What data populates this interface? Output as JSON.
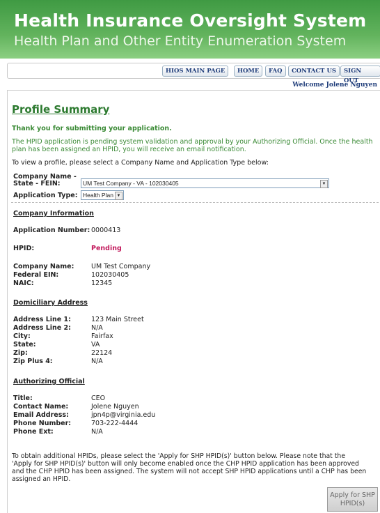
{
  "header": {
    "title": "Health Insurance Oversight System",
    "subtitle": "Health Plan and Other Entity Enumeration System"
  },
  "nav": {
    "items": [
      "HIOS MAIN PAGE",
      "HOME",
      "FAQ",
      "CONTACT US",
      "SIGN OUT"
    ]
  },
  "welcome": "Welcome Jolene Nguyen",
  "page": {
    "title": "Profile Summary",
    "thank_you": "Thank you for submitting your application.",
    "notice_line1": "The HPID application is pending system validation and approval by your Authorizing Official. Once the health",
    "notice_line2": "plan has been assigned an HPID, you will receive an email notification.",
    "select_prompt": "To view a profile, please select a Company Name and Application Type below:"
  },
  "filters": {
    "company_label_line1": "Company Name -",
    "company_label_line2": "State - FEIN:",
    "company_value": "UM Test Company - VA - 102030405",
    "apptype_label": "Application Type:",
    "apptype_value": "Health Plan"
  },
  "company_info": {
    "heading": "Company Information",
    "app_number_label": "Application Number:",
    "app_number": "0000413",
    "hpid_label": "HPID:",
    "hpid": "Pending",
    "company_name_label": "Company Name:",
    "company_name": "UM Test Company",
    "fein_label": "Federal EIN:",
    "fein": "102030405",
    "naic_label": "NAIC:",
    "naic": "12345"
  },
  "address": {
    "heading": "Domiciliary Address",
    "line1_label": "Address Line 1:",
    "line1": "123 Main Street",
    "line2_label": "Address Line 2:",
    "line2": "N/A",
    "city_label": "City:",
    "city": "Fairfax",
    "state_label": "State:",
    "state": "VA",
    "zip_label": "Zip:",
    "zip": "22124",
    "zip4_label": "Zip Plus 4:",
    "zip4": "N/A"
  },
  "official": {
    "heading": "Authorizing Official",
    "title_label": "Title:",
    "title": "CEO",
    "contact_label": "Contact Name:",
    "contact": "Jolene Nguyen",
    "email_label": "Email Address:",
    "email": "jpn4p@virginia.edu",
    "phone_label": "Phone Number:",
    "phone": "703-222-4444",
    "ext_label": "Phone Ext:",
    "ext": "N/A"
  },
  "footer": {
    "line1": "To obtain additional HPIDs, please select the 'Apply for SHP HPID(s)' button below. Please note that the",
    "line2": "'Apply for SHP HPID(s)' button will only become enabled once the CHP HPID application has been approved",
    "line3": "and the CHP HPID has been assigned. The system will not accept SHP HPID applications until a CHP has been",
    "line4": "assigned an HPID.",
    "apply_line1": "Apply for SHP",
    "apply_line2": "HPID(s)"
  }
}
